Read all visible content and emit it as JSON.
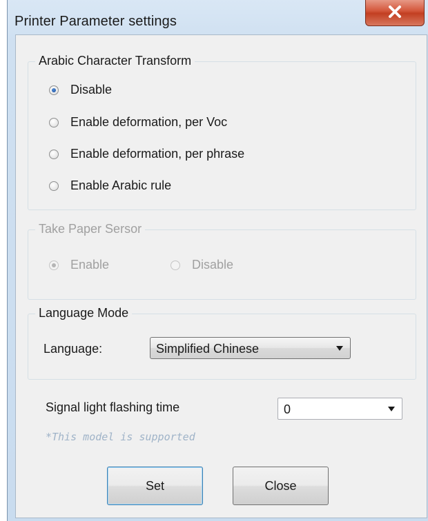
{
  "window": {
    "title": "Printer Parameter settings"
  },
  "arabic": {
    "title": "Arabic Character Transform",
    "options": [
      {
        "label": "Disable",
        "selected": true
      },
      {
        "label": "Enable deformation, per Voc",
        "selected": false
      },
      {
        "label": "Enable deformation, per phrase",
        "selected": false
      },
      {
        "label": "Enable Arabic rule",
        "selected": false
      }
    ]
  },
  "paper_sensor": {
    "title": "Take Paper Sersor",
    "enabled": false,
    "options": [
      {
        "label": "Enable",
        "selected": true
      },
      {
        "label": "Disable",
        "selected": false
      }
    ]
  },
  "language_mode": {
    "title": "Language Mode",
    "language_label": "Language:",
    "language_value": "Simplified Chinese"
  },
  "signal": {
    "label": "Signal light flashing time",
    "value": "0",
    "note": "*This model is supported"
  },
  "buttons": {
    "set": "Set",
    "close": "Close"
  },
  "icons": {
    "close": "close-icon",
    "dropdown": "chevron-down-icon"
  },
  "colors": {
    "close_button": "#c9452a",
    "disabled_text": "#a0a0a0",
    "note_text": "#9fb3c8",
    "default_button_border": "#3c7fb1"
  }
}
